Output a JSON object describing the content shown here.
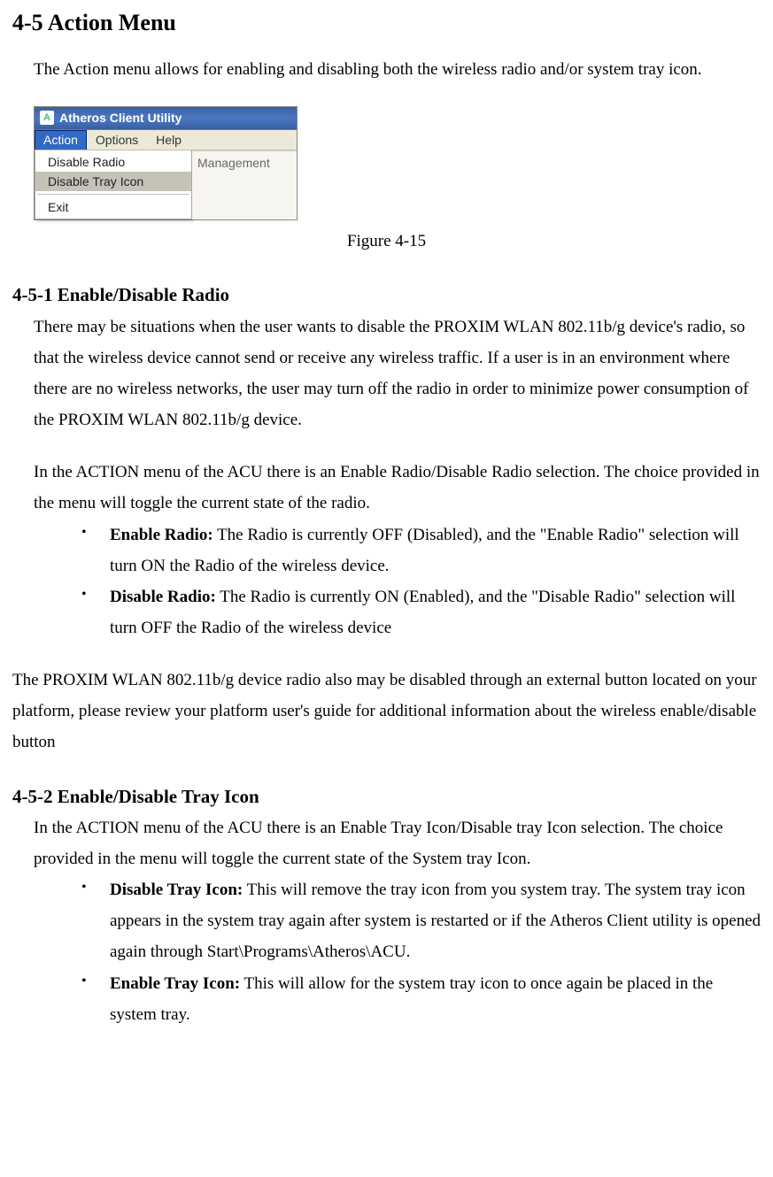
{
  "title": "4-5 Action Menu",
  "intro": "The Action menu allows for enabling and disabling both the wireless radio and/or system tray icon.",
  "screenshot": {
    "window_title": "Atheros Client Utility",
    "menus": [
      "Action",
      "Options",
      "Help"
    ],
    "dropdown": {
      "items": [
        "Disable Radio",
        "Disable Tray Icon"
      ],
      "exit": "Exit"
    },
    "tab_behind": "Management"
  },
  "figure_caption": "Figure 4-15",
  "section1": {
    "heading": "4-5-1 Enable/Disable Radio",
    "para1": "There may be situations when the user wants to disable the PROXIM WLAN 802.11b/g device's radio, so that the wireless device cannot send or receive any wireless traffic.  If a user is in an environment where there are no wireless networks, the user may turn off the radio in order to minimize power consumption of the PROXIM WLAN 802.11b/g  device.",
    "para2": "In the ACTION menu of the ACU there is an Enable Radio/Disable Radio selection.  The choice provided in the menu will toggle the current state of the radio.",
    "bullets": [
      {
        "label": "Enable Radio:",
        "text": " The Radio is currently OFF (Disabled), and the \"Enable Radio\" selection will turn ON the Radio of the wireless device."
      },
      {
        "label": "Disable Radio:",
        "text": " The Radio is currently ON (Enabled), and the \"Disable Radio\" selection will turn OFF the Radio of the wireless device"
      }
    ],
    "para3": "The PROXIM WLAN 802.11b/g  device radio also may be disabled through an external button located on your platform, please review your platform user's guide for additional information about the wireless enable/disable button"
  },
  "section2": {
    "heading": "4-5-2 Enable/Disable Tray Icon",
    "para1": "In the ACTION menu of the ACU there is an Enable Tray Icon/Disable tray Icon selection.  The choice provided in the menu will toggle the current state of the System tray Icon.",
    "bullets": [
      {
        "label": "Disable Tray Icon:",
        "text": " This will remove the tray icon from you system tray.  The system tray icon appears in the system tray again after system is restarted or if the Atheros Client utility is opened again through Start\\Programs\\Atheros\\ACU."
      },
      {
        "label": "Enable Tray Icon:",
        "text": "  This will allow for the system tray icon to once again be placed in the system tray."
      }
    ]
  }
}
